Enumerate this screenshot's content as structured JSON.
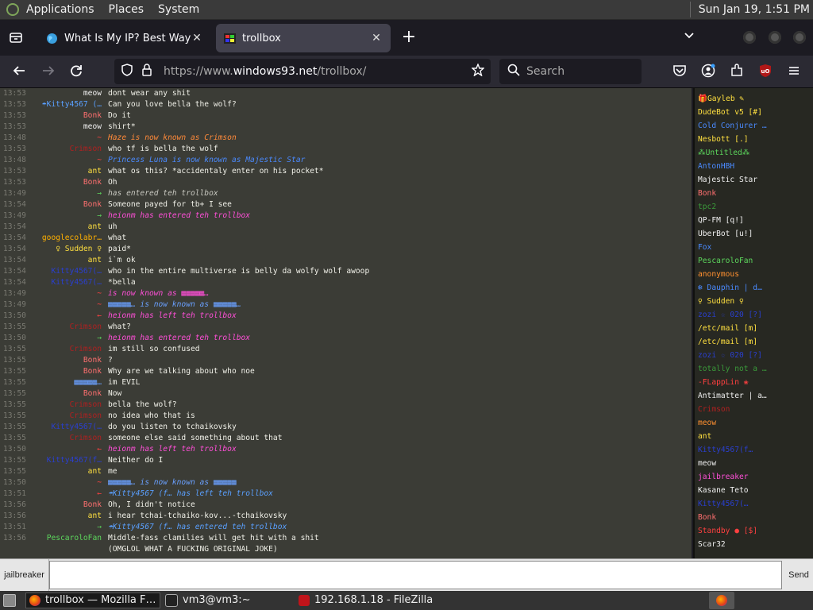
{
  "desktop": {
    "menu": [
      "Applications",
      "Places",
      "System"
    ],
    "clock": "Sun Jan 19,  1:51 PM"
  },
  "tabs": [
    {
      "title": "What Is My IP? Best Way To",
      "icon": "globe-icon",
      "active": false
    },
    {
      "title": "trollbox",
      "icon": "windows93-icon",
      "active": true
    }
  ],
  "url": {
    "prefix": "https://www.",
    "domain": "windows93.net",
    "path": "/trollbox/"
  },
  "search": {
    "placeholder": "Search"
  },
  "chat": [
    {
      "time": "13:53",
      "nick": "meow",
      "nick_color": "#f0f0f0",
      "msg": "dont wear any shit",
      "type": "msg"
    },
    {
      "time": "13:53",
      "nick": "☂Kitty4567 (…",
      "nick_color": "#5aa0ff",
      "msg": "Can you love bella the wolf?",
      "type": "msg"
    },
    {
      "time": "13:53",
      "nick": "Bonk",
      "nick_color": "#ff7070",
      "msg": "Do it",
      "type": "msg"
    },
    {
      "time": "13:53",
      "nick": "meow",
      "nick_color": "#f0f0f0",
      "msg": "shirt*",
      "type": "msg"
    },
    {
      "time": "13:48",
      "nick": "~",
      "nick_color": "#ff4040",
      "msg": "Haze is now known as Crimson",
      "type": "sys",
      "msg_color": "#ff8a3a"
    },
    {
      "time": "13:53",
      "nick": "Crimson",
      "nick_color": "#b02020",
      "msg": "who tf is bella the wolf",
      "type": "msg"
    },
    {
      "time": "13:48",
      "nick": "~",
      "nick_color": "#ff4040",
      "msg": "Princess Luna is now known as Majestic Star",
      "type": "sys",
      "msg_color": "#4a8aff"
    },
    {
      "time": "13:53",
      "nick": "ant",
      "nick_color": "#ffe040",
      "msg": "what os this? *accidentaly enter on his pocket*",
      "type": "msg"
    },
    {
      "time": "13:53",
      "nick": "Bonk",
      "nick_color": "#ff7070",
      "msg": "Oh",
      "type": "msg"
    },
    {
      "time": "13:49",
      "nick": "→",
      "nick_color": "#5cd65c",
      "msg": "  has entered teh trollbox",
      "type": "sys"
    },
    {
      "time": "13:54",
      "nick": "Bonk",
      "nick_color": "#ff7070",
      "msg": "Someone payed for tb+ I see",
      "type": "msg"
    },
    {
      "time": "13:49",
      "nick": "→",
      "nick_color": "#5cd65c",
      "msg": "heionm has entered teh trollbox",
      "type": "sys",
      "msg_color": "#ff4fd8"
    },
    {
      "time": "13:54",
      "nick": "ant",
      "nick_color": "#ffe040",
      "msg": "uh",
      "type": "msg"
    },
    {
      "time": "13:54",
      "nick": "googlecolabr…",
      "nick_color": "#ffb000",
      "msg": "what",
      "type": "msg"
    },
    {
      "time": "13:54",
      "nick": "♀ Sudden ♀",
      "nick_color": "#ffe040",
      "msg": "paid*",
      "type": "msg"
    },
    {
      "time": "13:54",
      "nick": "ant",
      "nick_color": "#ffe040",
      "msg": "i`m ok",
      "type": "msg"
    },
    {
      "time": "13:54",
      "nick": "Kitty4567(…",
      "nick_color": "#2a3fd0",
      "msg": "who in the entire multiverse is belly da wolfy wolf awoop",
      "type": "msg"
    },
    {
      "time": "13:54",
      "nick": "Kitty4567(…",
      "nick_color": "#2a3fd0",
      "msg": "*bella",
      "type": "msg"
    },
    {
      "time": "13:49",
      "nick": "~",
      "nick_color": "#ff4040",
      "msg": "  is now known as ▦▦▦▦▦…",
      "type": "sys",
      "msg_color": "#ff4fd8"
    },
    {
      "time": "13:49",
      "nick": "~",
      "nick_color": "#ff4040",
      "msg": "▦▦▦▦▦…  is now known as ▦▦▦▦▦…",
      "type": "sys",
      "msg_color": "#6aa0ff"
    },
    {
      "time": "13:50",
      "nick": "←",
      "nick_color": "#ff4040",
      "msg": "heionm has left teh trollbox",
      "type": "sys",
      "msg_color": "#ff4fd8"
    },
    {
      "time": "13:55",
      "nick": "Crimson",
      "nick_color": "#b02020",
      "msg": "what?",
      "type": "msg"
    },
    {
      "time": "13:50",
      "nick": "→",
      "nick_color": "#5cd65c",
      "msg": "heionm has entered teh trollbox",
      "type": "sys",
      "msg_color": "#ff4fd8"
    },
    {
      "time": "13:55",
      "nick": "Crimson",
      "nick_color": "#b02020",
      "msg": "im still so confused",
      "type": "msg"
    },
    {
      "time": "13:55",
      "nick": "Bonk",
      "nick_color": "#ff7070",
      "msg": "?",
      "type": "msg"
    },
    {
      "time": "13:55",
      "nick": "Bonk",
      "nick_color": "#ff7070",
      "msg": "Why are we talking about who noe",
      "type": "msg"
    },
    {
      "time": "13:55",
      "nick": "▦▦▦▦▦…",
      "nick_color": "#6aa0ff",
      "msg": "im EVIL",
      "type": "msg"
    },
    {
      "time": "13:55",
      "nick": "Bonk",
      "nick_color": "#ff7070",
      "msg": "Now",
      "type": "msg"
    },
    {
      "time": "13:55",
      "nick": "Crimson",
      "nick_color": "#b02020",
      "msg": "bella the wolf?",
      "type": "msg"
    },
    {
      "time": "13:55",
      "nick": "Crimson",
      "nick_color": "#b02020",
      "msg": "no idea who that is",
      "type": "msg"
    },
    {
      "time": "13:55",
      "nick": "Kitty4567(…",
      "nick_color": "#2a3fd0",
      "msg": "do you listen to tchaikovsky",
      "type": "msg"
    },
    {
      "time": "13:55",
      "nick": "Crimson",
      "nick_color": "#b02020",
      "msg": "someone else said something about that",
      "type": "msg"
    },
    {
      "time": "13:50",
      "nick": "←",
      "nick_color": "#ff4040",
      "msg": "heionm has left teh trollbox",
      "type": "sys",
      "msg_color": "#ff4fd8"
    },
    {
      "time": "13:55",
      "nick": "Kitty4567(f…",
      "nick_color": "#2a3fd0",
      "msg": "Neither do I",
      "type": "msg"
    },
    {
      "time": "13:55",
      "nick": "ant",
      "nick_color": "#ffe040",
      "msg": "me",
      "type": "msg"
    },
    {
      "time": "13:50",
      "nick": "~",
      "nick_color": "#ff4040",
      "msg": "▦▦▦▦▦…  is now known as ▦▦▦▦▦",
      "type": "sys",
      "msg_color": "#6aa0ff"
    },
    {
      "time": "13:51",
      "nick": "←",
      "nick_color": "#ff4040",
      "msg": "☂Kitty4567 (f…  has left teh trollbox",
      "type": "sys",
      "msg_color": "#5aa0ff"
    },
    {
      "time": "13:56",
      "nick": "Bonk",
      "nick_color": "#ff7070",
      "msg": "Oh, I didn't notice",
      "type": "msg"
    },
    {
      "time": "13:56",
      "nick": "ant",
      "nick_color": "#ffe040",
      "msg": "i hear tchai-tchaiko-kov...-tchaikovsky",
      "type": "msg"
    },
    {
      "time": "13:51",
      "nick": "→",
      "nick_color": "#5cd65c",
      "msg": "☂Kitty4567 (f…  has entered teh trollbox",
      "type": "sys",
      "msg_color": "#5aa0ff"
    },
    {
      "time": "13:56",
      "nick": "PescaroloFan",
      "nick_color": "#5cd65c",
      "msg": "Middle-fass clamilies will get hit with a shit",
      "type": "msg"
    },
    {
      "time": "",
      "nick": "",
      "nick_color": "#5cd65c",
      "msg": "(OMGLOL WHAT A FUCKING ORIGINAL JOKE)",
      "type": "msg"
    }
  ],
  "users": [
    {
      "name": "🎁Gayleb ✎",
      "color": "#ffe040"
    },
    {
      "name": "DudeBot v5 [#]",
      "color": "#ffe040"
    },
    {
      "name": "Cold Conjurer …",
      "color": "#4a8aff"
    },
    {
      "name": "Nesbott [.]",
      "color": "#ffe040"
    },
    {
      "name": "⁂Untitled⁂",
      "color": "#5cd65c"
    },
    {
      "name": "AntonHBH",
      "color": "#4a8aff"
    },
    {
      "name": "Majestic Star",
      "color": "#f0f0f0"
    },
    {
      "name": "Bonk",
      "color": "#ff7070"
    },
    {
      "name": "tpc2",
      "color": "#3a9a3a"
    },
    {
      "name": "QP-FM [q!]",
      "color": "#f0f0f0"
    },
    {
      "name": "UberBot [u!]",
      "color": "#f0f0f0"
    },
    {
      "name": "Fox",
      "color": "#4a8aff"
    },
    {
      "name": "PescaroloFan",
      "color": "#5cd65c"
    },
    {
      "name": "anonymous",
      "color": "#ff9030"
    },
    {
      "name": "❄ Dauphin | d…",
      "color": "#4a8aff"
    },
    {
      "name": "♀ Sudden ♀",
      "color": "#ffe040"
    },
    {
      "name": "zozi ☆ 020 [?]",
      "color": "#2a3fd0"
    },
    {
      "name": "/etc/mail [m]",
      "color": "#ffe040"
    },
    {
      "name": "/etc/mail [m]",
      "color": "#ffe040"
    },
    {
      "name": "zozi ☆ 020 [?]",
      "color": "#2a3fd0"
    },
    {
      "name": "totally not a …",
      "color": "#3a9a3a"
    },
    {
      "name": "-FLappLin ❀",
      "color": "#ff4040"
    },
    {
      "name": "Antimatter | a…",
      "color": "#f0f0f0"
    },
    {
      "name": "Crimson",
      "color": "#b02020"
    },
    {
      "name": "meow",
      "color": "#ff9030"
    },
    {
      "name": "ant",
      "color": "#ffe040"
    },
    {
      "name": "Kitty4567(f…",
      "color": "#2a3fd0"
    },
    {
      "name": "meow",
      "color": "#f0f0f0"
    },
    {
      "name": "jailbreaker",
      "color": "#ff4fd8"
    },
    {
      "name": "Kasane Teto",
      "color": "#f0f0f0"
    },
    {
      "name": "Kitty4567(…",
      "color": "#2a3fd0"
    },
    {
      "name": "Bonk",
      "color": "#ff7070"
    },
    {
      "name": "Standby ● [$]",
      "color": "#ff4040"
    },
    {
      "name": "Scar32",
      "color": "#f0f0f0"
    }
  ],
  "input": {
    "nickname": "jailbreaker",
    "value": "",
    "send_label": "Send"
  },
  "taskbar": [
    {
      "title": "trollbox — Mozilla F…",
      "icon": "firefox-icon",
      "active": true
    },
    {
      "title": "vm3@vm3:~",
      "icon": "terminal-icon",
      "active": false
    },
    {
      "title": "192.168.1.18 - FileZilla",
      "icon": "filezilla-icon",
      "active": false
    }
  ],
  "colors": {
    "chat_bg": "#3b3c36",
    "userlist_bg": "#272822",
    "timestamp": "#7a7a72"
  }
}
